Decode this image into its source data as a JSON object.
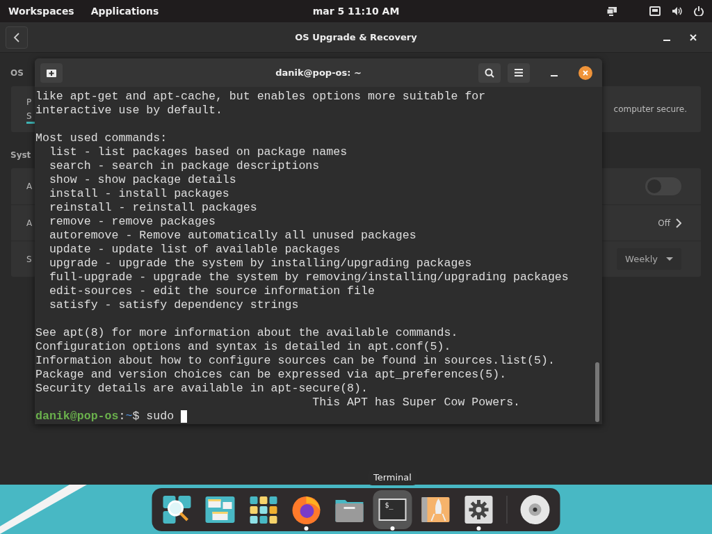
{
  "top_bar": {
    "items": [
      "Workspaces",
      "Applications"
    ],
    "clock": "mar 5  11:10 AM"
  },
  "settings_window": {
    "title": "OS Upgrade & Recovery",
    "section_1": "OS",
    "card_1": {
      "line_1": "P",
      "line_2": "S",
      "trailing_text": "computer secure."
    },
    "section_2": "Syst",
    "rows": [
      {
        "kind": "toggle",
        "label": "A",
        "on": false
      },
      {
        "kind": "link",
        "label": "A",
        "value": "Off"
      },
      {
        "kind": "dropdown",
        "label": "S",
        "value": "Weekly"
      }
    ]
  },
  "terminal": {
    "title": "danik@pop-os: ~",
    "blocks": [
      [
        "like apt-get and apt-cache, but enables options more suitable for",
        "interactive use by default."
      ],
      [
        "Most used commands:",
        "  list - list packages based on package names",
        "  search - search in package descriptions",
        "  show - show package details",
        "  install - install packages",
        "  reinstall - reinstall packages",
        "  remove - remove packages",
        "  autoremove - Remove automatically all unused packages",
        "  update - update list of available packages",
        "  upgrade - upgrade the system by installing/upgrading packages",
        "  full-upgrade - upgrade the system by removing/installing/upgrading packages",
        "  edit-sources - edit the source information file",
        "  satisfy - satisfy dependency strings"
      ],
      [
        "See apt(8) for more information about the available commands.",
        "Configuration options and syntax is detailed in apt.conf(5).",
        "Information about how to configure sources can be found in sources.list(5).",
        "Package and version choices can be expressed via apt_preferences(5).",
        "Security details are available in apt-secure(8).",
        "                                        This APT has Super Cow Powers."
      ]
    ],
    "prompt": {
      "user": "danik@pop-os",
      "separator": ":",
      "path": "~",
      "symbol": "$",
      "command": "sudo "
    }
  },
  "tooltip": "Terminal",
  "dock": [
    {
      "kind": "search",
      "selected": false
    },
    {
      "kind": "workspaces",
      "selected": false
    },
    {
      "kind": "apps",
      "selected": false
    },
    {
      "kind": "browser",
      "running": true,
      "selected": false
    },
    {
      "kind": "files",
      "selected": false
    },
    {
      "kind": "terminal",
      "running": true,
      "selected": true,
      "icon_text": "$_"
    },
    {
      "kind": "launcher",
      "selected": false
    },
    {
      "kind": "settings",
      "running": true,
      "selected": false
    },
    {
      "kind": "separator"
    },
    {
      "kind": "disc",
      "selected": false
    }
  ]
}
